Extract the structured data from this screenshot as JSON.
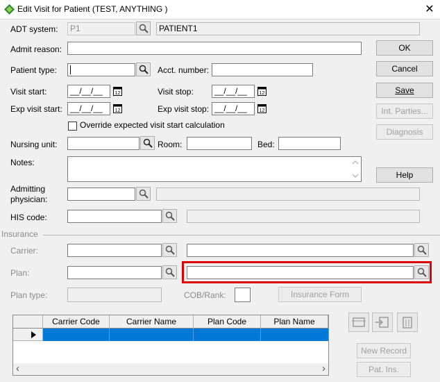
{
  "window": {
    "title": "Edit Visit for Patient (TEST, ANYTHING )",
    "close": "✕"
  },
  "labels": {
    "adt_system": "ADT system:",
    "admit_reason": "Admit reason:",
    "patient_type": "Patient type:",
    "acct_number": "Acct. number:",
    "visit_start": "Visit start:",
    "visit_stop": "Visit stop:",
    "exp_visit_start": "Exp visit start:",
    "exp_visit_stop": "Exp visit stop:",
    "override": "Override expected visit start calculation",
    "nursing_unit": "Nursing unit:",
    "room": "Room:",
    "bed": "Bed:",
    "notes": "Notes:",
    "admitting_physician_1": "Admitting",
    "admitting_physician_2": "physician:",
    "his_code": "HIS code:",
    "insurance": "Insurance",
    "carrier": "Carrier:",
    "plan": "Plan:",
    "plan_type": "Plan type:",
    "cob_rank": "COB/Rank:"
  },
  "fields": {
    "adt_system_value": "P1",
    "adt_system_name": "PATIENT1",
    "date_placeholder": "__/__/__"
  },
  "buttons": {
    "ok": "OK",
    "cancel": "Cancel",
    "save": "Save",
    "int_parties": "Int. Parties...",
    "diagnosis": "Diagnosis",
    "help": "Help",
    "insurance_form": "Insurance Form",
    "new_record": "New Record",
    "pat_ins": "Pat. Ins."
  },
  "grid": {
    "columns": [
      "Carrier Code",
      "Carrier Name",
      "Plan Code",
      "Plan Name"
    ],
    "scroll_left": "‹",
    "scroll_right": "›"
  },
  "colors": {
    "selection": "#0078d7",
    "highlight": "#e00000"
  }
}
